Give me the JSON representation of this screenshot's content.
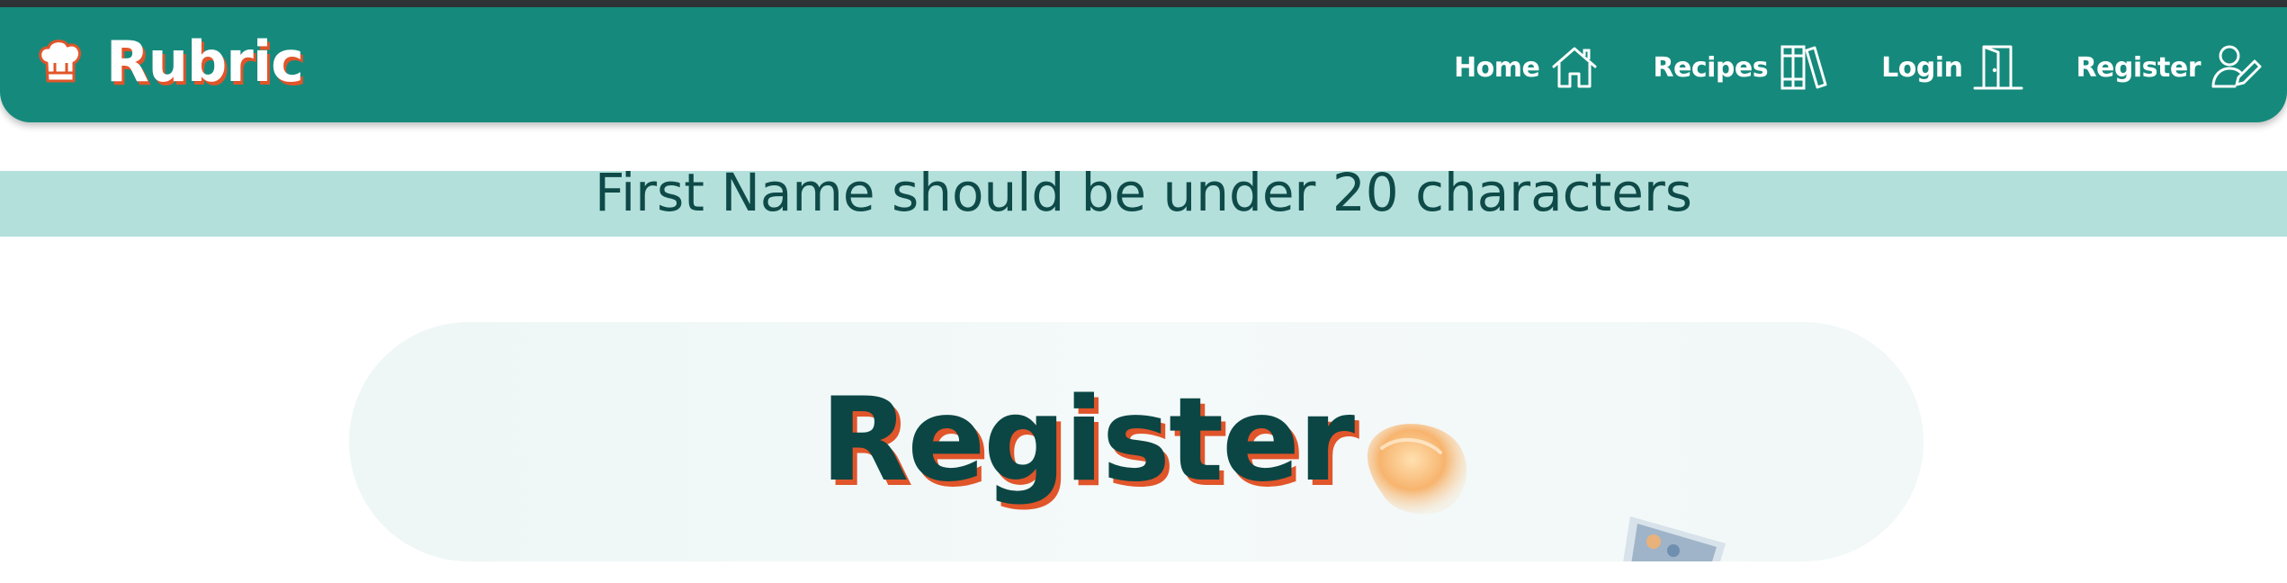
{
  "brand": {
    "name": "Rubric",
    "icon": "chef-hat-icon"
  },
  "nav": {
    "items": [
      {
        "label": "Home",
        "icon": "house-icon"
      },
      {
        "label": "Recipes",
        "icon": "books-icon"
      },
      {
        "label": "Login",
        "icon": "door-icon"
      },
      {
        "label": "Register",
        "icon": "user-edit-icon"
      }
    ]
  },
  "alert": {
    "message": "First Name should be under 20 characters"
  },
  "hero": {
    "title": "Register"
  },
  "colors": {
    "navbar": "#158a7c",
    "alert_bg": "#b4e0dc",
    "title": "#0b4644",
    "accent": "#e0552a"
  }
}
